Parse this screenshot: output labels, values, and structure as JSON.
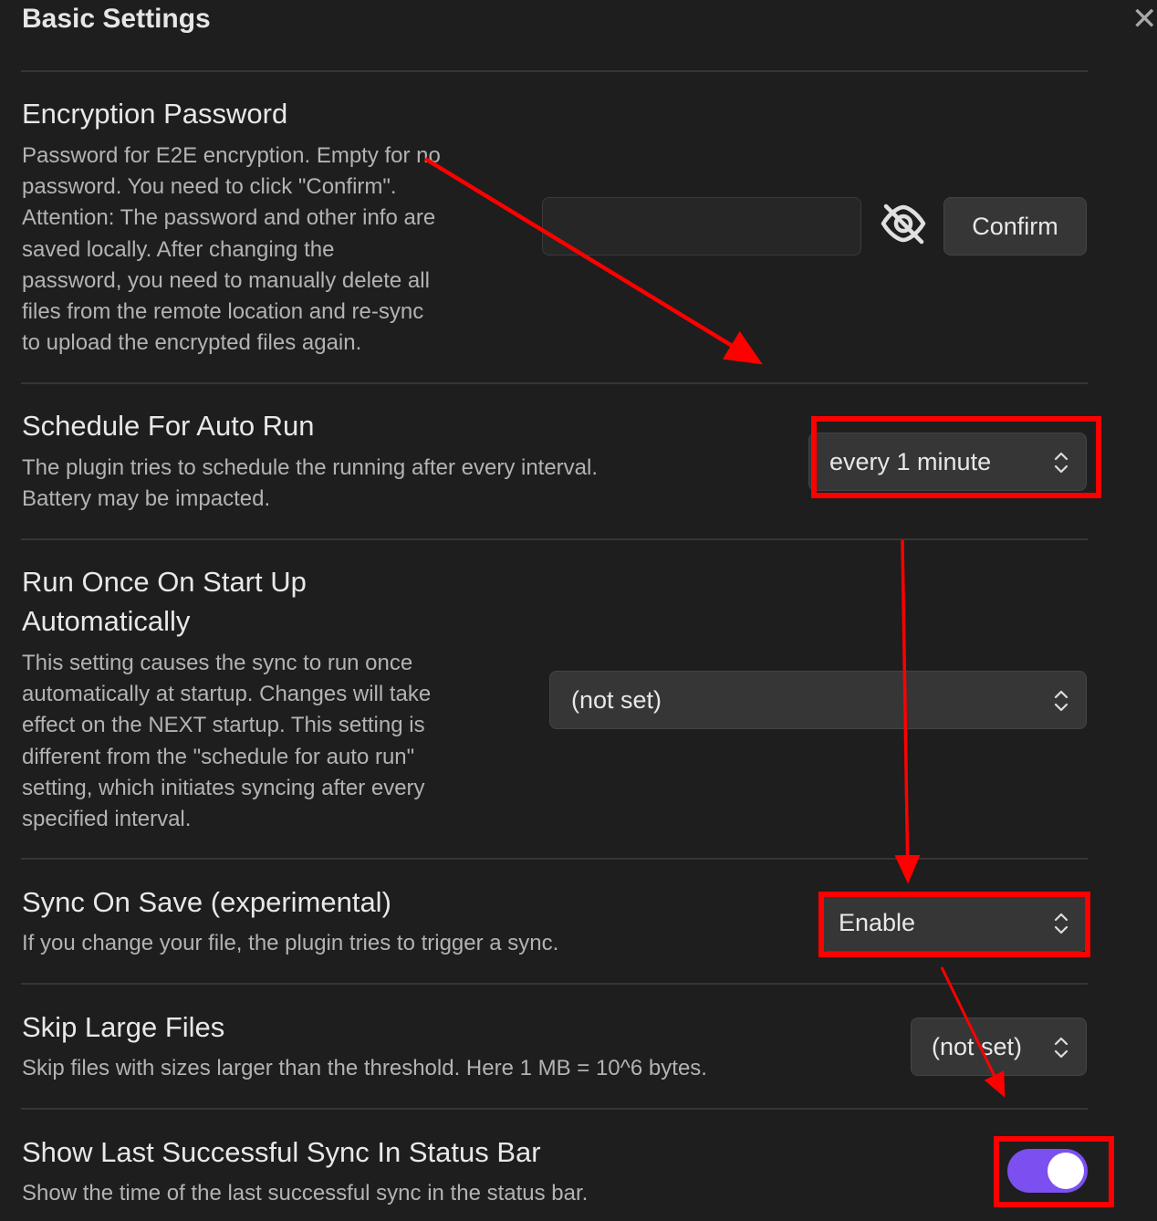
{
  "header": {
    "title": "Basic Settings",
    "close_icon": "close-icon"
  },
  "settings": {
    "encryption": {
      "name": "Encryption Password",
      "desc_lines": [
        "Password for E2E encryption. Empty for no",
        "password. You need to click \"Confirm\".",
        "Attention: The password and other info are",
        "saved locally. After changing the",
        "password, you need to manually delete all",
        "files from the remote location and re-sync",
        "to upload the encrypted files again."
      ],
      "input_value": "",
      "visibility_icon": "eye-off-icon",
      "confirm_label": "Confirm"
    },
    "schedule": {
      "name": "Schedule For Auto Run",
      "desc_lines": [
        "The plugin tries to schedule the running after every interval.",
        "Battery may be impacted."
      ],
      "selected": "every 1 minute"
    },
    "run_once": {
      "name_lines": [
        "Run Once On Start Up",
        "Automatically"
      ],
      "desc_lines": [
        "This setting causes the sync to run once",
        "automatically at startup. Changes will take",
        "effect on the NEXT startup. This setting is",
        "different from the \"schedule for auto run\"",
        "setting, which initiates syncing after every",
        "specified interval."
      ],
      "selected": "(not set)"
    },
    "sync_on_save": {
      "name": "Sync On Save (experimental)",
      "desc_lines": [
        "If you change your file, the plugin tries to trigger a sync."
      ],
      "selected": "Enable"
    },
    "skip_large": {
      "name": "Skip Large Files",
      "desc_lines": [
        "Skip files with sizes larger than the threshold. Here 1 MB = 10^6 bytes."
      ],
      "selected": "(not set)"
    },
    "show_last_sync": {
      "name": "Show Last Successful Sync In Status Bar",
      "desc_lines": [
        "Show the time of the last successful sync in the status bar."
      ],
      "toggle_on": true
    }
  },
  "colors": {
    "background": "#1e1e1e",
    "toggle_accent": "#7b4ff0",
    "annotation_red": "#ff0000"
  }
}
